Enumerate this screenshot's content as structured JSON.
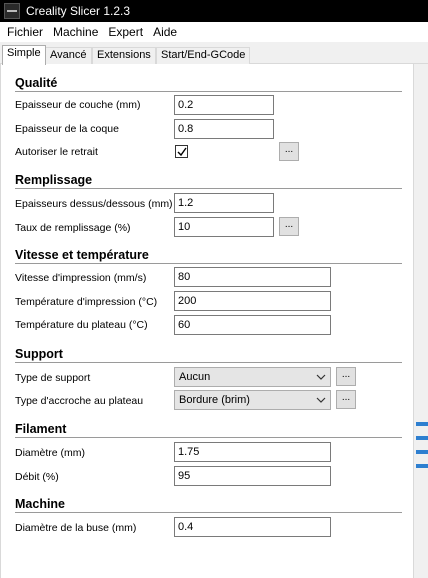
{
  "window": {
    "title": "Creality Slicer 1.2.3"
  },
  "menu": {
    "items": [
      "Fichier",
      "Machine",
      "Expert",
      "Aide"
    ]
  },
  "tabs": [
    "Simple",
    "Avancé",
    "Extensions",
    "Start/End-GCode"
  ],
  "active_tab": "Simple",
  "dots_label": "...",
  "sections": {
    "qualite": {
      "title": "Qualité",
      "layer_height": {
        "label": "Epaisseur de couche (mm)",
        "value": "0.2"
      },
      "shell_thickness": {
        "label": "Epaisseur de la coque",
        "value": "0.8"
      },
      "retraction": {
        "label": "Autoriser le retrait",
        "checked": true
      }
    },
    "remplissage": {
      "title": "Remplissage",
      "top_bottom": {
        "label": "Epaisseurs dessus/dessous (mm)",
        "value": "1.2"
      },
      "fill_density": {
        "label": "Taux de remplissage (%)",
        "value": "10"
      }
    },
    "vitesse": {
      "title": "Vitesse et température",
      "print_speed": {
        "label": "Vitesse d'impression (mm/s)",
        "value": "80"
      },
      "print_temp": {
        "label": "Température d'impression (°C)",
        "value": "200"
      },
      "bed_temp": {
        "label": "Température du plateau (°C)",
        "value": "60"
      }
    },
    "support": {
      "title": "Support",
      "support_type": {
        "label": "Type de support",
        "value": "Aucun"
      },
      "adhesion": {
        "label": "Type d'accroche au plateau",
        "value": "Bordure (brim)"
      }
    },
    "filament": {
      "title": "Filament",
      "diameter": {
        "label": "Diamètre (mm)",
        "value": "1.75"
      },
      "flow": {
        "label": "Débit (%)",
        "value": "95"
      }
    },
    "machine": {
      "title": "Machine",
      "nozzle": {
        "label": "Diamètre de la buse (mm)",
        "value": "0.4"
      }
    }
  },
  "colors": {
    "titlebar": "#000000",
    "accent": "#2e7fd0",
    "rule": "#9a9a9a"
  }
}
